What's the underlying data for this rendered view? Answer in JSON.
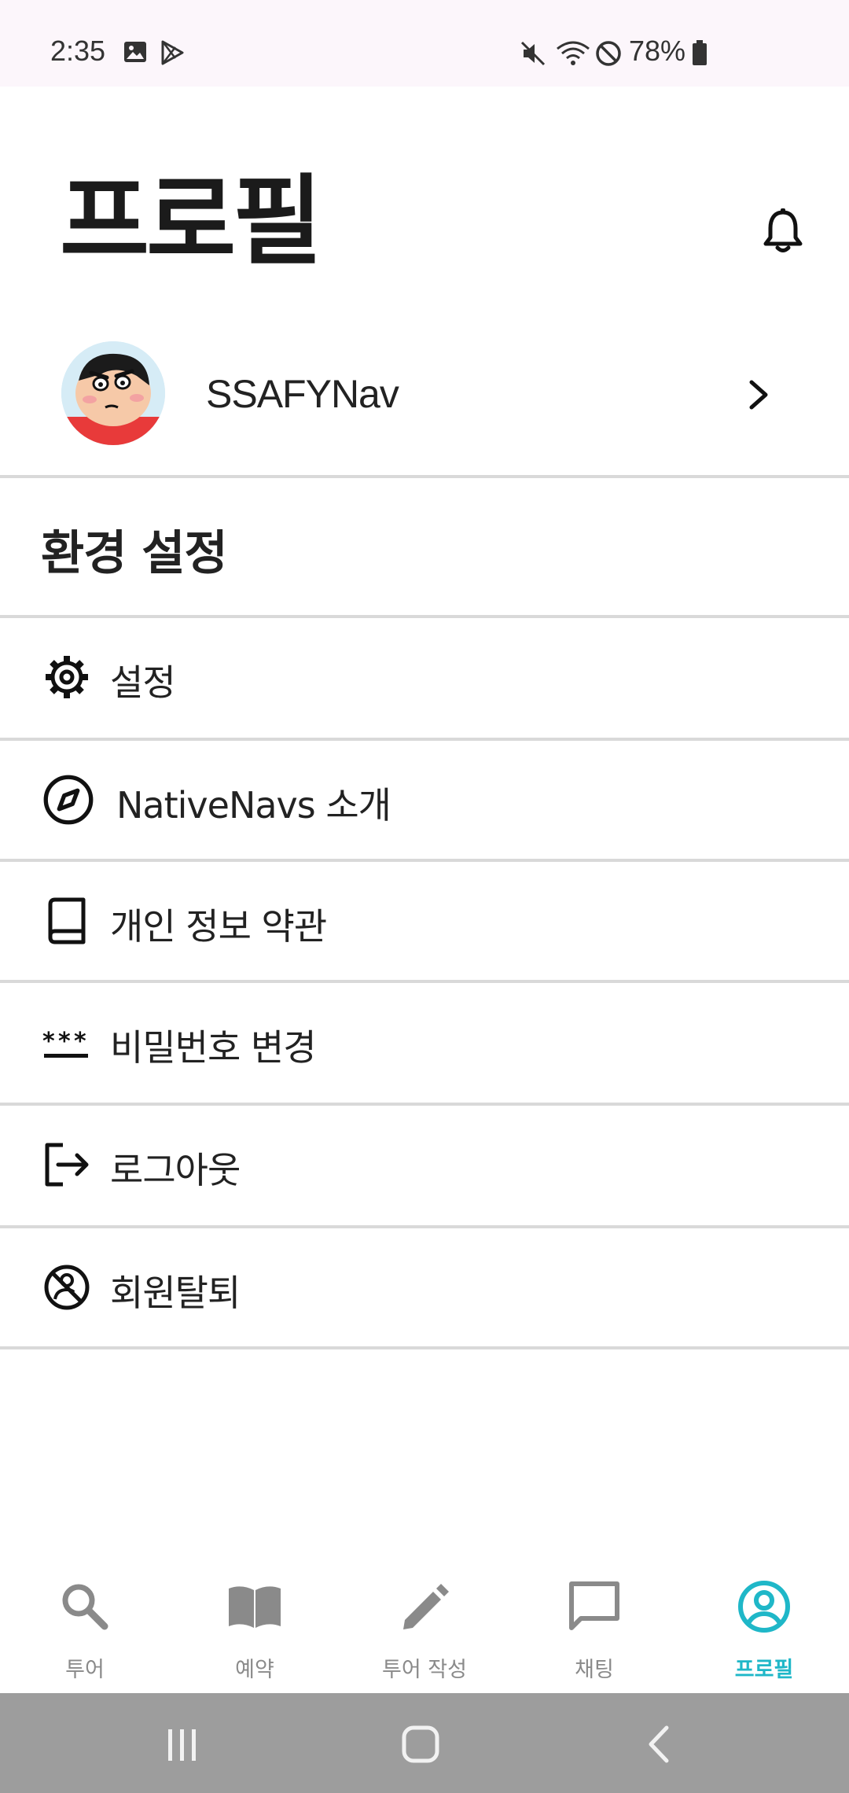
{
  "status_bar": {
    "time": "2:35",
    "battery": "78%"
  },
  "header": {
    "title": "프로필"
  },
  "profile": {
    "username": "SSAFYNav"
  },
  "settings": {
    "section_title": "환경 설정"
  },
  "menu": [
    {
      "label": "설정",
      "icon": "gear-icon"
    },
    {
      "label": "NativeNavs 소개",
      "icon": "compass-icon"
    },
    {
      "label": "개인 정보 약관",
      "icon": "book-icon"
    },
    {
      "label": "비밀번호 변경",
      "icon": "password-icon"
    },
    {
      "label": "로그아웃",
      "icon": "logout-icon"
    },
    {
      "label": "회원탈퇴",
      "icon": "block-icon"
    }
  ],
  "bottom_nav": [
    {
      "label": "투어",
      "icon": "search-icon",
      "active": false
    },
    {
      "label": "예약",
      "icon": "book-open-icon",
      "active": false
    },
    {
      "label": "투어 작성",
      "icon": "pencil-icon",
      "active": false
    },
    {
      "label": "채팅",
      "icon": "chat-icon",
      "active": false
    },
    {
      "label": "프로필",
      "icon": "profile-icon",
      "active": true
    }
  ],
  "colors": {
    "accent": "#1fb7c8",
    "inactive": "#8a8a8a",
    "divider": "#d9d9d9"
  }
}
